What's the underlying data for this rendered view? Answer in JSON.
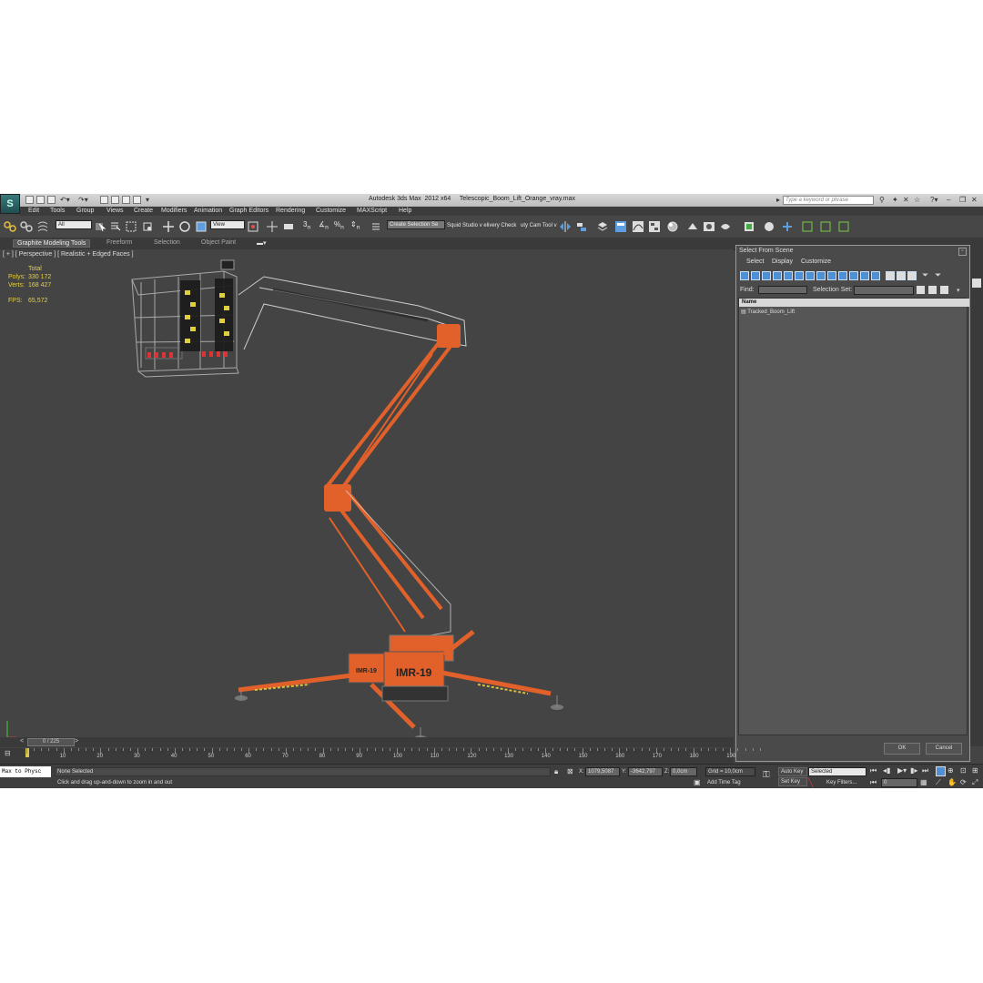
{
  "window": {
    "title": "Autodesk 3ds Max  2012 x64     Telescopic_Boom_Lift_Orange_vray.max",
    "search_placeholder": "Type a keyword or phrase"
  },
  "menu": [
    "Edit",
    "Tools",
    "Group",
    "Views",
    "Create",
    "Modifiers",
    "Animation",
    "Graph Editors",
    "Rendering",
    "Customize",
    "MAXScript",
    "Help"
  ],
  "toolbar": {
    "selection_filter": "All",
    "reference_coord": "View",
    "named_selection": "Create Selection Se",
    "script_label_1": "Squid Studio v elivery Check",
    "script_label_2": "uty Cam Tool v"
  },
  "ribbon_tabs": [
    "Graphite Modeling Tools",
    "Freeform",
    "Selection",
    "Object Paint"
  ],
  "viewport": {
    "label": "[ + ] [ Perspective ] [ Realistic + Edged Faces ]",
    "stats": {
      "total_label": "Total",
      "polys_label": "Polys:",
      "polys_value": "330 172",
      "verts_label": "Verts:",
      "verts_value": "168 427",
      "fps_label": "FPS:",
      "fps_value": "65,572"
    },
    "model_text_1": "IMR-19",
    "model_text_2": "IMR-19"
  },
  "dialog": {
    "title": "Select From Scene",
    "menus": [
      "Select",
      "Display",
      "Customize"
    ],
    "find_label": "Find:",
    "selection_set_label": "Selection Set:",
    "column_header": "Name",
    "items": [
      "Tracked_Boom_Lift"
    ],
    "ok_label": "OK",
    "cancel_label": "Cancel"
  },
  "timeline": {
    "frame_indicator": "0 / 225",
    "ticks": [
      "0",
      "10",
      "20",
      "30",
      "40",
      "50",
      "60",
      "70",
      "80",
      "90",
      "100",
      "110",
      "120",
      "130",
      "140",
      "150",
      "160",
      "170",
      "180",
      "190"
    ]
  },
  "status": {
    "maxscript": "Max to Physc",
    "selection": "None Selected",
    "prompt": "Click and drag up-and-down to zoom in and out",
    "x_label": "X:",
    "x_value": "1079,5087",
    "y_label": "Y:",
    "y_value": "-3642,797",
    "z_label": "Z:",
    "z_value": "0,0cm",
    "grid": "Grid = 10,0cm",
    "add_time_tag": "Add Time Tag",
    "auto_key": "Auto Key",
    "set_key": "Set Key",
    "key_mode": "Selected",
    "key_filters": "Key Filters...",
    "frame": "0"
  },
  "colors": {
    "accent_orange": "#e2612a",
    "viewport_bg": "#444444",
    "stat_yellow": "#e7d13a"
  }
}
